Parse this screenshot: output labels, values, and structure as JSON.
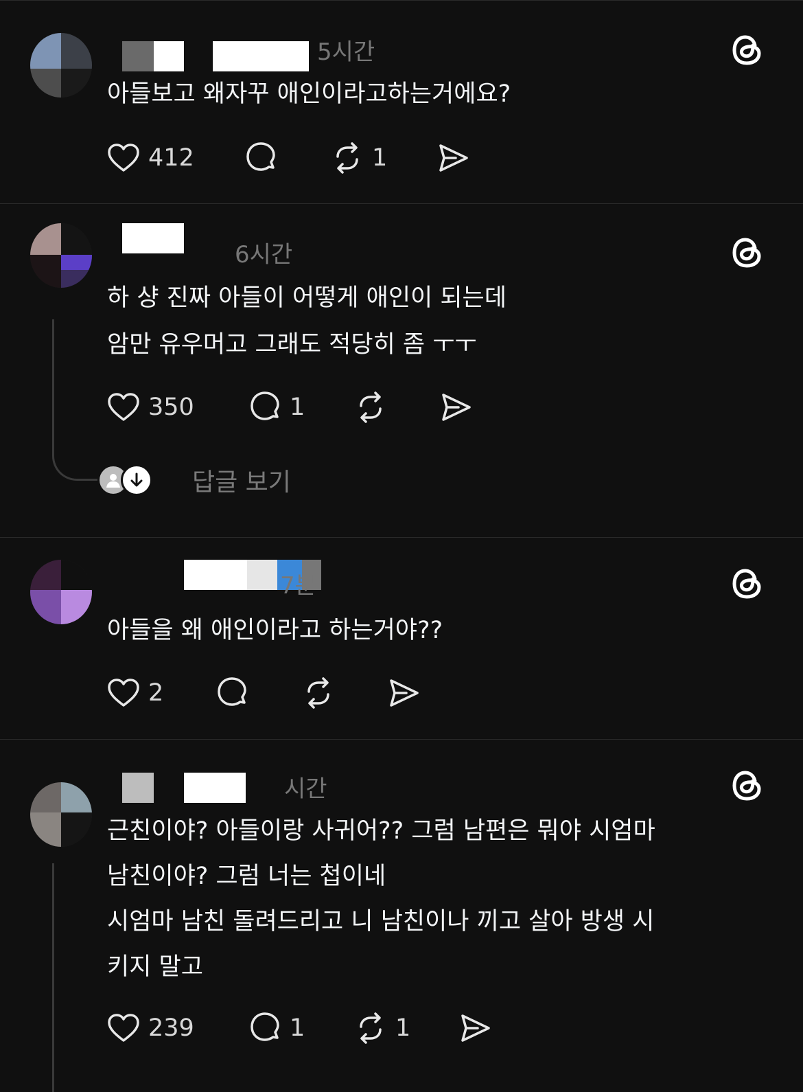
{
  "icons": {
    "like": "heart-icon",
    "reply": "comment-icon",
    "repost": "repost-icon",
    "share": "send-icon",
    "threads": "threads-logo-icon"
  },
  "posts": [
    {
      "time": "5시간",
      "lines": [
        "아들보고 왜자꾸 애인이라고하는거에요?"
      ],
      "likes": "412",
      "replies": "",
      "reposts": "1"
    },
    {
      "time": "6시간",
      "lines": [
        "하 샹 진짜 아들이 어떻게 애인이 되는데",
        "암만 유우머고 그래도 적당히 좀 ㅜㅜ"
      ],
      "likes": "350",
      "replies": "1",
      "reposts": "",
      "see_replies": "답글 보기"
    },
    {
      "time": "7분",
      "lines": [
        "아들을 왜 애인이라고 하는거야??"
      ],
      "likes": "2",
      "replies": "",
      "reposts": ""
    },
    {
      "time": "시간",
      "lines": [
        "근친이야? 아들이랑 사귀어?? 그럼 남편은 뭐야 시엄마",
        "남친이야? 그럼 너는 첩이네",
        "시엄마 남친 돌려드리고 니 남친이나 끼고 살아 방생 시",
        "키지 말고"
      ],
      "likes": "239",
      "replies": "1",
      "reposts": "1"
    }
  ]
}
